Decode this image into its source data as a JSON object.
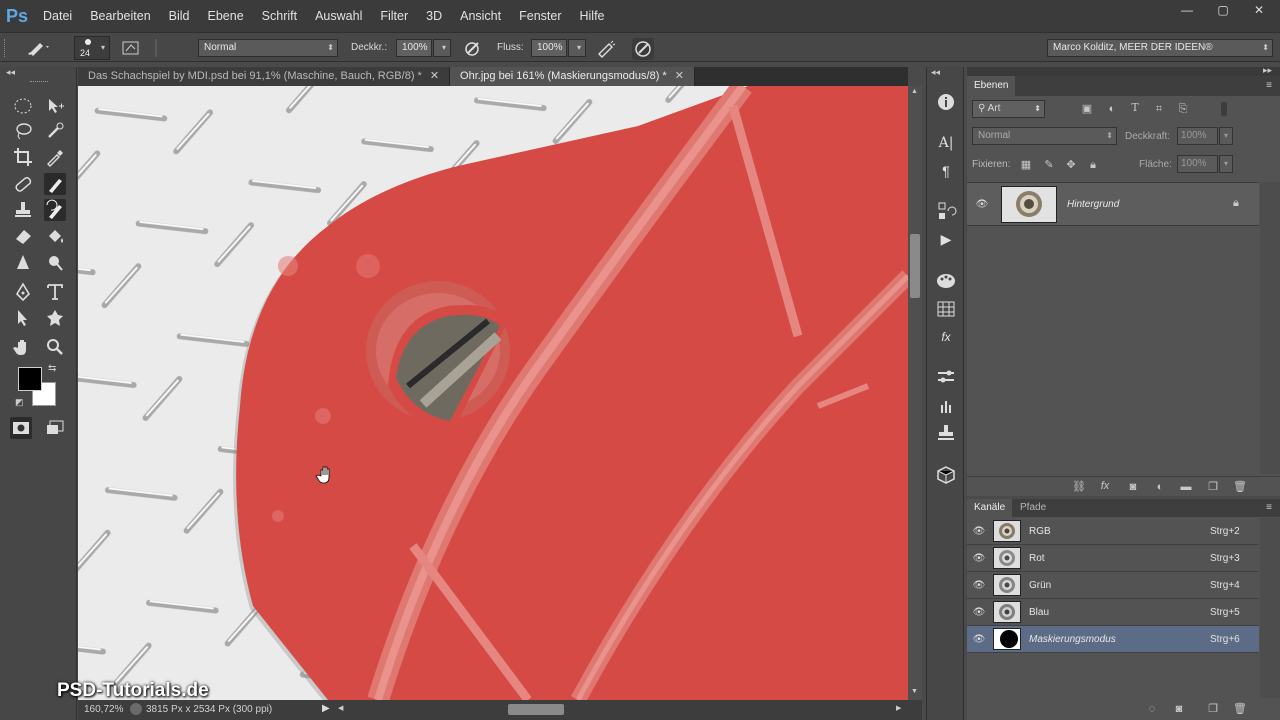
{
  "menubar": {
    "logo": "Ps",
    "items": [
      "Datei",
      "Bearbeiten",
      "Bild",
      "Ebene",
      "Schrift",
      "Auswahl",
      "Filter",
      "3D",
      "Ansicht",
      "Fenster",
      "Hilfe"
    ],
    "window_controls": [
      "—",
      "▢",
      "✕"
    ]
  },
  "options": {
    "brush_size": "24",
    "mode_value": "Normal",
    "opacity_label": "Deckkr.:",
    "opacity_value": "100%",
    "flow_label": "Fluss:",
    "flow_value": "100%",
    "workspace": "Marco Kolditz, MEER DER IDEEN®"
  },
  "tabs": [
    {
      "label": "Das Schachspiel by MDI.psd bei 91,1% (Maschine, Bauch, RGB/8) *",
      "active": false
    },
    {
      "label": "Ohr.jpg bei 161% (Maskierungsmodus/8) *",
      "active": true
    }
  ],
  "status": {
    "zoom": "160,72%",
    "doc_info": "3815 Px x 2534 Px (300 ppi)"
  },
  "watermark": "PSD-Tutorials.de",
  "layers_panel": {
    "tab": "Ebenen",
    "filter_kind": "Art",
    "blend_mode": "Normal",
    "opacity_label": "Deckkraft:",
    "opacity_value": "100%",
    "lock_label": "Fixieren:",
    "fill_label": "Fläche:",
    "fill_value": "100%",
    "layer_name": "Hintergrund"
  },
  "channels_panel": {
    "tabs": [
      "Kanäle",
      "Pfade"
    ],
    "channels": [
      {
        "name": "RGB",
        "shortcut": "Strg+2",
        "selected": false
      },
      {
        "name": "Rot",
        "shortcut": "Strg+3",
        "selected": false
      },
      {
        "name": "Grün",
        "shortcut": "Strg+4",
        "selected": false
      },
      {
        "name": "Blau",
        "shortcut": "Strg+5",
        "selected": false
      },
      {
        "name": "Maskierungsmodus",
        "shortcut": "Strg+6",
        "selected": true
      }
    ]
  },
  "colors": {
    "mask_red": "#d64a46",
    "ps_blue": "#5fa8e6",
    "selected_row": "#5d6c86"
  }
}
